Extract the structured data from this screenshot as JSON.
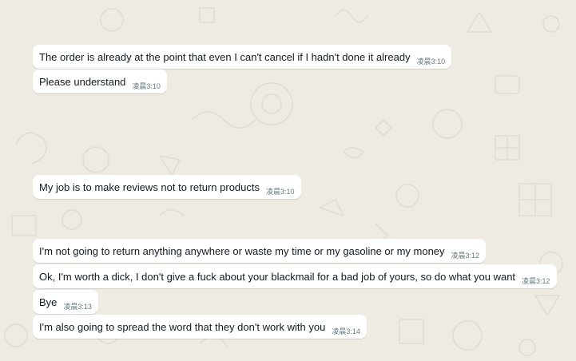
{
  "chat": {
    "background_color": "#efeae2",
    "bubble_color": "#ffffff",
    "messages": [
      {
        "text": "The order is already at the point that even I can't cancel if I hadn't done it already",
        "time": "凌晨3:10"
      },
      {
        "text": "Please understand",
        "time": "凌晨3:10"
      },
      {
        "text": "My job is to make reviews not to return products",
        "time": "凌晨3:10"
      },
      {
        "text": "I'm not going to return anything anywhere or waste my time or my gasoline or my money",
        "time": "凌晨3:12"
      },
      {
        "text": "Ok, I'm worth a dick, I don't give a fuck about your blackmail for a bad job of yours, so do what you want",
        "time": "凌晨3:12"
      },
      {
        "text": "Bye",
        "time": "凌晨3:13"
      },
      {
        "text": "I'm also going to spread the word that they don't work with you",
        "time": "凌晨3:14"
      }
    ]
  }
}
